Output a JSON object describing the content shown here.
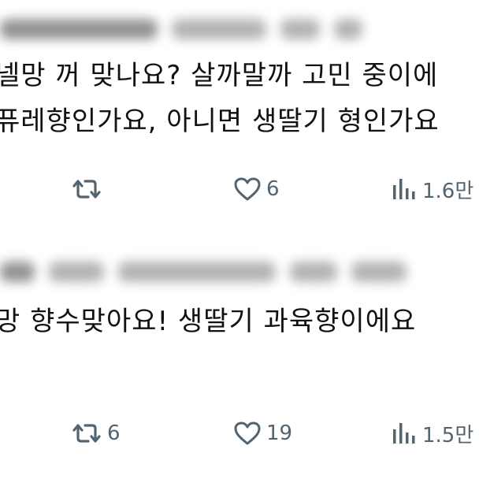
{
  "tweets": [
    {
      "text_lines": [
        "넬망 꺼 맞나요? 살까말까 고민 중이에",
        "퓨레향인가요, 아니면 생딸기 형인가요"
      ],
      "retweet_count": "",
      "like_count": "6",
      "view_count": "1.6만"
    },
    {
      "text_lines": [
        "망 향수맞아요!  생딸기 과육향이에요"
      ],
      "retweet_count": "6",
      "like_count": "19",
      "view_count": "1.5만"
    }
  ],
  "icons": {
    "retweet": "retweet-icon",
    "like": "heart-icon",
    "views": "bar-chart-icon"
  },
  "colors": {
    "text": "#111111",
    "action_gray": "#536471",
    "background": "#ffffff"
  }
}
